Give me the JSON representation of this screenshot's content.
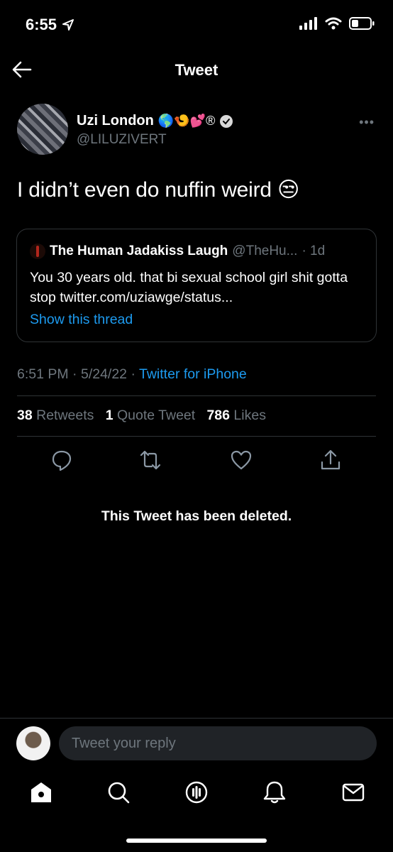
{
  "status_bar": {
    "time": "6:55"
  },
  "header": {
    "title": "Tweet"
  },
  "tweet": {
    "author_name": "Uzi London",
    "author_handle": "@LILUZIVERT",
    "name_emojis": "🌎🍤💕®",
    "text": "I didn’t even do nuffin weird 😒",
    "quote": {
      "author_name": "The Human Jadakiss Laugh",
      "author_handle": "@TheHu...",
      "age": "· 1d",
      "text": "You 30 years old. that bi sexual school girl shit gotta stop twitter.com/uziawge/status...",
      "show_thread": "Show this thread"
    },
    "time": "6:51 PM",
    "date": "5/24/22",
    "source": "Twitter for iPhone",
    "stats": {
      "retweets_count": "38",
      "retweets_label": "Retweets",
      "quotes_count": "1",
      "quotes_label": "Quote Tweet",
      "likes_count": "786",
      "likes_label": "Likes"
    }
  },
  "deleted_message": "This Tweet has been deleted.",
  "reply": {
    "placeholder": "Tweet your reply"
  },
  "colors": {
    "accent": "#1d9bf0",
    "muted": "#6e767d",
    "divider": "#2f3336",
    "verified": "#d9d9d9"
  }
}
